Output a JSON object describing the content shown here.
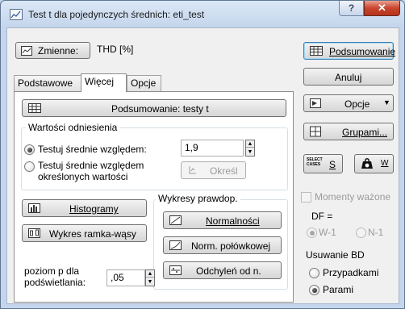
{
  "window": {
    "title": "Test t dla pojedynczych średnich: eti_test",
    "help_label": "?",
    "close_label": "✕"
  },
  "variables": {
    "button_label": "Zmienne:",
    "value": "THD [%]"
  },
  "tabs": [
    {
      "label": "Podstawowe"
    },
    {
      "label": "Więcej"
    },
    {
      "label": "Opcje"
    }
  ],
  "more_tab": {
    "summary_button": "Podsumowanie: testy t",
    "reference_group": {
      "title": "Wartości odniesienia",
      "option_test_against": "Testuj średnie względem:",
      "option_test_against_value": "1,9",
      "option_test_against_specified_line1": "Testuj średnie względem",
      "option_test_against_specified_line2": "określonych wartości",
      "specify_button": "Określ"
    },
    "histograms_button": "Histogramy",
    "boxplot_button": "Wykres ramka-wąsy",
    "probability_plots": {
      "title": "Wykresy prawdop.",
      "normal_button": "Normalności",
      "half_normal_button": "Norm. połówkowej",
      "deviation_button": "Odchyleń od n."
    },
    "p_level": {
      "label_line1": "poziom p dla",
      "label_line2": "podświetlania:",
      "value": ",05"
    }
  },
  "side_panel": {
    "summary_button": "Podsumowanie",
    "cancel_button": "Anuluj",
    "options_button": "Opcje",
    "by_group_button": "Grupami...",
    "select_cases_icon_text": "SELECT CASES",
    "select_cases_label": "S",
    "weight_label": "W",
    "weighted_moments": "Momenty ważone",
    "df_label": "DF =",
    "df_options": [
      "W-1",
      "N-1"
    ],
    "missing_data": {
      "title": "Usuwanie BD",
      "options": [
        "Przypadkami",
        "Parami"
      ]
    }
  }
}
